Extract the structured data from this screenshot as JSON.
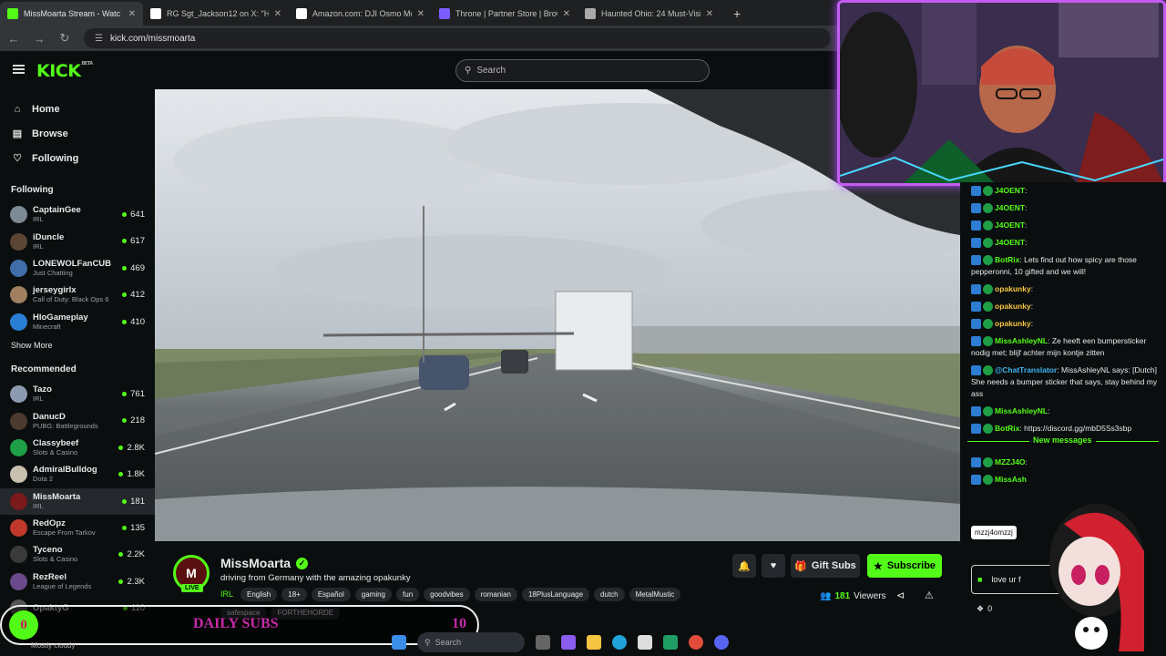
{
  "browser": {
    "tabs": [
      {
        "title": "MissMoarta Stream - Watc",
        "icon": "kick-icon",
        "color": "#53fc18",
        "active": true
      },
      {
        "title": "RG Sgt_Jackson12 on X: \"Hey @",
        "icon": "x-icon",
        "color": "#ffffff"
      },
      {
        "title": "Amazon.com: DJI Osmo Mobile",
        "icon": "amazon-icon",
        "color": "#ffffff"
      },
      {
        "title": "Throne | Partner Store | Browse",
        "icon": "throne-icon",
        "color": "#7b5cff"
      },
      {
        "title": "Haunted Ohio: 24 Must-Visit Pl",
        "icon": "globe-icon",
        "color": "#aaaaaa"
      }
    ],
    "new_tab": "+",
    "url": "kick.com/missmoarta"
  },
  "kick": {
    "logo": "KICK",
    "beta": "BETA",
    "search_placeholder": "Search"
  },
  "sidebar": {
    "nav": [
      {
        "label": "Home",
        "icon": "home-icon"
      },
      {
        "label": "Browse",
        "icon": "browse-icon"
      },
      {
        "label": "Following",
        "icon": "heart-icon"
      }
    ],
    "following_title": "Following",
    "following": [
      {
        "name": "CaptainGee",
        "game": "IRL",
        "viewers": "641",
        "color": "#7d8a96"
      },
      {
        "name": "iDuncle",
        "game": "IRL",
        "viewers": "617",
        "color": "#5b4636"
      },
      {
        "name": "LONEWOLFanCUB",
        "game": "Just Chatting",
        "viewers": "469",
        "color": "#3f6ea8"
      },
      {
        "name": "jerseygirlx",
        "game": "Call of Duty: Black Ops 6",
        "viewers": "412",
        "color": "#a08060"
      },
      {
        "name": "HloGameplay",
        "game": "Minecraft",
        "viewers": "410",
        "color": "#2a7fd4"
      }
    ],
    "show_more": "Show More",
    "recommended_title": "Recommended",
    "recommended": [
      {
        "name": "Tazo",
        "game": "IRL",
        "viewers": "761",
        "color": "#8c9bb0"
      },
      {
        "name": "DanucD",
        "game": "PUBG: Battlegrounds",
        "viewers": "218",
        "color": "#4a3a30"
      },
      {
        "name": "Classybeef",
        "game": "Slots & Casino",
        "viewers": "2.8K",
        "color": "#1e9e45"
      },
      {
        "name": "AdmiralBulldog",
        "game": "Dota 2",
        "viewers": "1.8K",
        "color": "#c9c0b0"
      },
      {
        "name": "MissMoarta",
        "game": "IRL",
        "viewers": "181",
        "color": "#7a1a1a",
        "selected": true
      },
      {
        "name": "RedOpz",
        "game": "Escape From Tarkov",
        "viewers": "135",
        "color": "#c0392b"
      },
      {
        "name": "Tyceno",
        "game": "Slots & Casino",
        "viewers": "2.2K",
        "color": "#3a3a3a"
      },
      {
        "name": "RezReel",
        "game": "League of Legends",
        "viewers": "2.3K",
        "color": "#6a4a8a"
      },
      {
        "name": "OpaktyG",
        "game": "",
        "viewers": "110",
        "color": "#555555"
      }
    ]
  },
  "stream": {
    "channel": "MissMoarta",
    "title": "driving from Germany with the amazing opakunky",
    "live": "LIVE",
    "category": "IRL",
    "tags": [
      "English",
      "18+",
      "Español",
      "gaming",
      "fun",
      "goodvibes",
      "romanian",
      "18PlusLanguage",
      "dutch",
      "MetalMustic"
    ],
    "tags2": [
      "safespace",
      "FORTHEHORDE"
    ],
    "gift_label": "Gift Subs",
    "subscribe_label": "Subscribe",
    "viewers_count": "181",
    "viewers_label": "Viewers"
  },
  "chat": {
    "messages": [
      {
        "user": "J4OENT",
        "text": ":",
        "ucolor": "#53fc18"
      },
      {
        "user": "J4OENT",
        "text": ":",
        "ucolor": "#53fc18"
      },
      {
        "user": "J4OENT",
        "text": ":",
        "ucolor": "#53fc18"
      },
      {
        "user": "J4OENT",
        "text": ":",
        "ucolor": "#53fc18"
      },
      {
        "user": "BotRix",
        "text": ": Lets find out how spicy are those pepperonni, 10 gifted and we will!",
        "ucolor": "#53fc18"
      },
      {
        "user": "opakunky",
        "text": ":",
        "ucolor": "#f5c542"
      },
      {
        "user": "opakunky",
        "text": ":",
        "ucolor": "#f5c542"
      },
      {
        "user": "opakunky",
        "text": ":",
        "ucolor": "#f5c542"
      },
      {
        "user": "MissAshleyNL",
        "text": ": Ze heeft een bumpersticker nodig met; blijf achter mijn kontje zitten",
        "ucolor": "#53fc18"
      },
      {
        "user": "@ChatTranslator",
        "text": ": MissAshleyNL says: [Dutch] She needs a bumper sticker that says, stay behind my ass",
        "ucolor": "#40b4f0"
      },
      {
        "user": "MissAshleyNL",
        "text": ":",
        "ucolor": "#53fc18"
      },
      {
        "user": "BotRix",
        "text": ": https://discord.gg/mbD5Ss3sbp",
        "ucolor": "#53fc18"
      }
    ],
    "new_messages": "New messages",
    "after": [
      {
        "user": "MZZJ4O",
        "text": ":",
        "ucolor": "#53fc18"
      },
      {
        "user": "MissAsh",
        "text": "",
        "ucolor": "#53fc18"
      }
    ],
    "tooltip": "mzzj4omzzj",
    "input_text": "love ur f",
    "points": "0"
  },
  "overlay": {
    "daily_subs_label": "DAILY SUBS",
    "daily_subs_count": "0",
    "daily_subs_goal": "10",
    "weather": "Mostly cloudy"
  },
  "taskbar": {
    "search": "Search"
  }
}
